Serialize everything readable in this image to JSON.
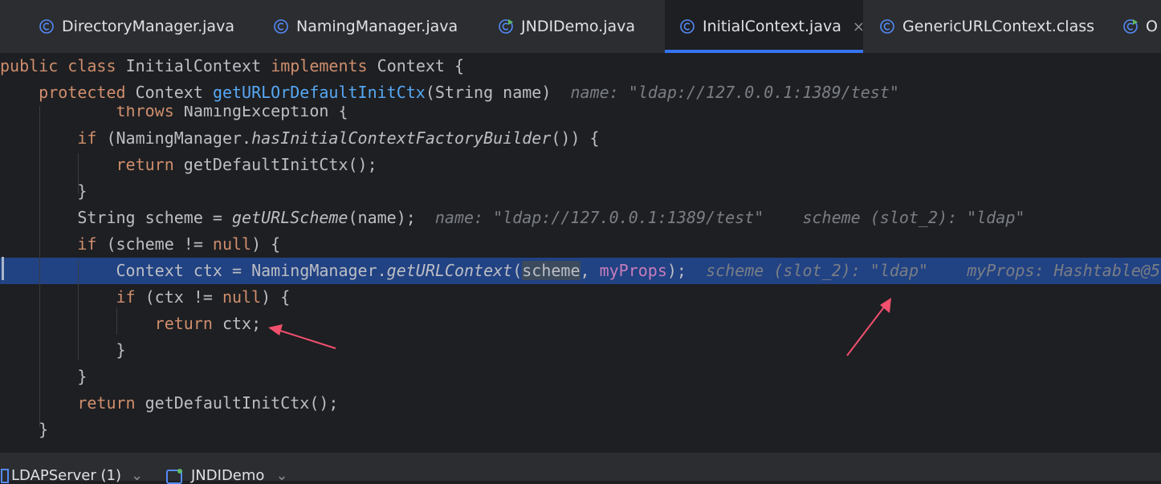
{
  "tabs": [
    {
      "label": "DirectoryManager.java",
      "icon": "java-class-icon"
    },
    {
      "label": "NamingManager.java",
      "icon": "java-class-icon"
    },
    {
      "label": "JNDIDemo.java",
      "icon": "java-runnable-class-icon"
    },
    {
      "label": "InitialContext.java",
      "icon": "java-class-icon",
      "active": true,
      "close": "×"
    },
    {
      "label": "GenericURLContext.class",
      "icon": "java-class-icon"
    },
    {
      "label": "O",
      "icon": "java-runnable-class-icon"
    }
  ],
  "code": {
    "sticky1": {
      "kw1": "public",
      "kw2": "class",
      "name": "InitialContext",
      "kw3": "implements",
      "rest": "Context {"
    },
    "sticky2": {
      "kw": "protected",
      "type": "Context",
      "method": "getURLOrDefaultInitCtx",
      "params": "(String name)",
      "hint": "name: \"ldap://127.0.0.1:1389/test\""
    },
    "l1": {
      "kw": "throws",
      "rest": "NamingException {"
    },
    "l2": {
      "kw": "if",
      "a": "(NamingManager.",
      "call": "hasInitialContextFactoryBuilder",
      "b": "()) {"
    },
    "l3": {
      "kw": "return",
      "rest": "getDefaultInitCtx();"
    },
    "l4": {
      "text": "}"
    },
    "l5": {
      "a": "String scheme = ",
      "call": "getURLScheme",
      "b": "(name);",
      "hint1": "name: \"ldap://127.0.0.1:1389/test\"",
      "hint2": "scheme (slot_2): \"ldap\""
    },
    "l6": {
      "kw": "if",
      "a": "(scheme != ",
      "kw2": "null",
      "b": ") {"
    },
    "l7": {
      "a": "Context ctx = NamingManager.",
      "call": "getURLContext",
      "p": "(",
      "sel": "scheme",
      "c": ", ",
      "field": "myProps",
      "d": ");",
      "hint1": "scheme (slot_2): \"ldap\"",
      "hint2": "myProps: Hashtable@5"
    },
    "l8": {
      "kw": "if",
      "a": "(ctx != ",
      "kw2": "null",
      "b": ") {"
    },
    "l9": {
      "kw": "return",
      "rest": "ctx;"
    },
    "l10": {
      "text": "}"
    },
    "l11": {
      "text": "}"
    },
    "l12": {
      "kw": "return",
      "rest": "getDefaultInitCtx();"
    },
    "l13": {
      "text": "}"
    }
  },
  "bottom_tabs": [
    {
      "label": "LDAPServer (1)",
      "chevron": "⌄"
    },
    {
      "label": "JNDIDemo",
      "chevron": "⌄"
    }
  ],
  "colors": {
    "keyword": "#cf8e6d",
    "method": "#56a8f5",
    "field": "#c77dbb",
    "hint": "#7a7e85",
    "highlight": "#214283",
    "accent": "#3574f0",
    "arrow": "#f0506e"
  }
}
